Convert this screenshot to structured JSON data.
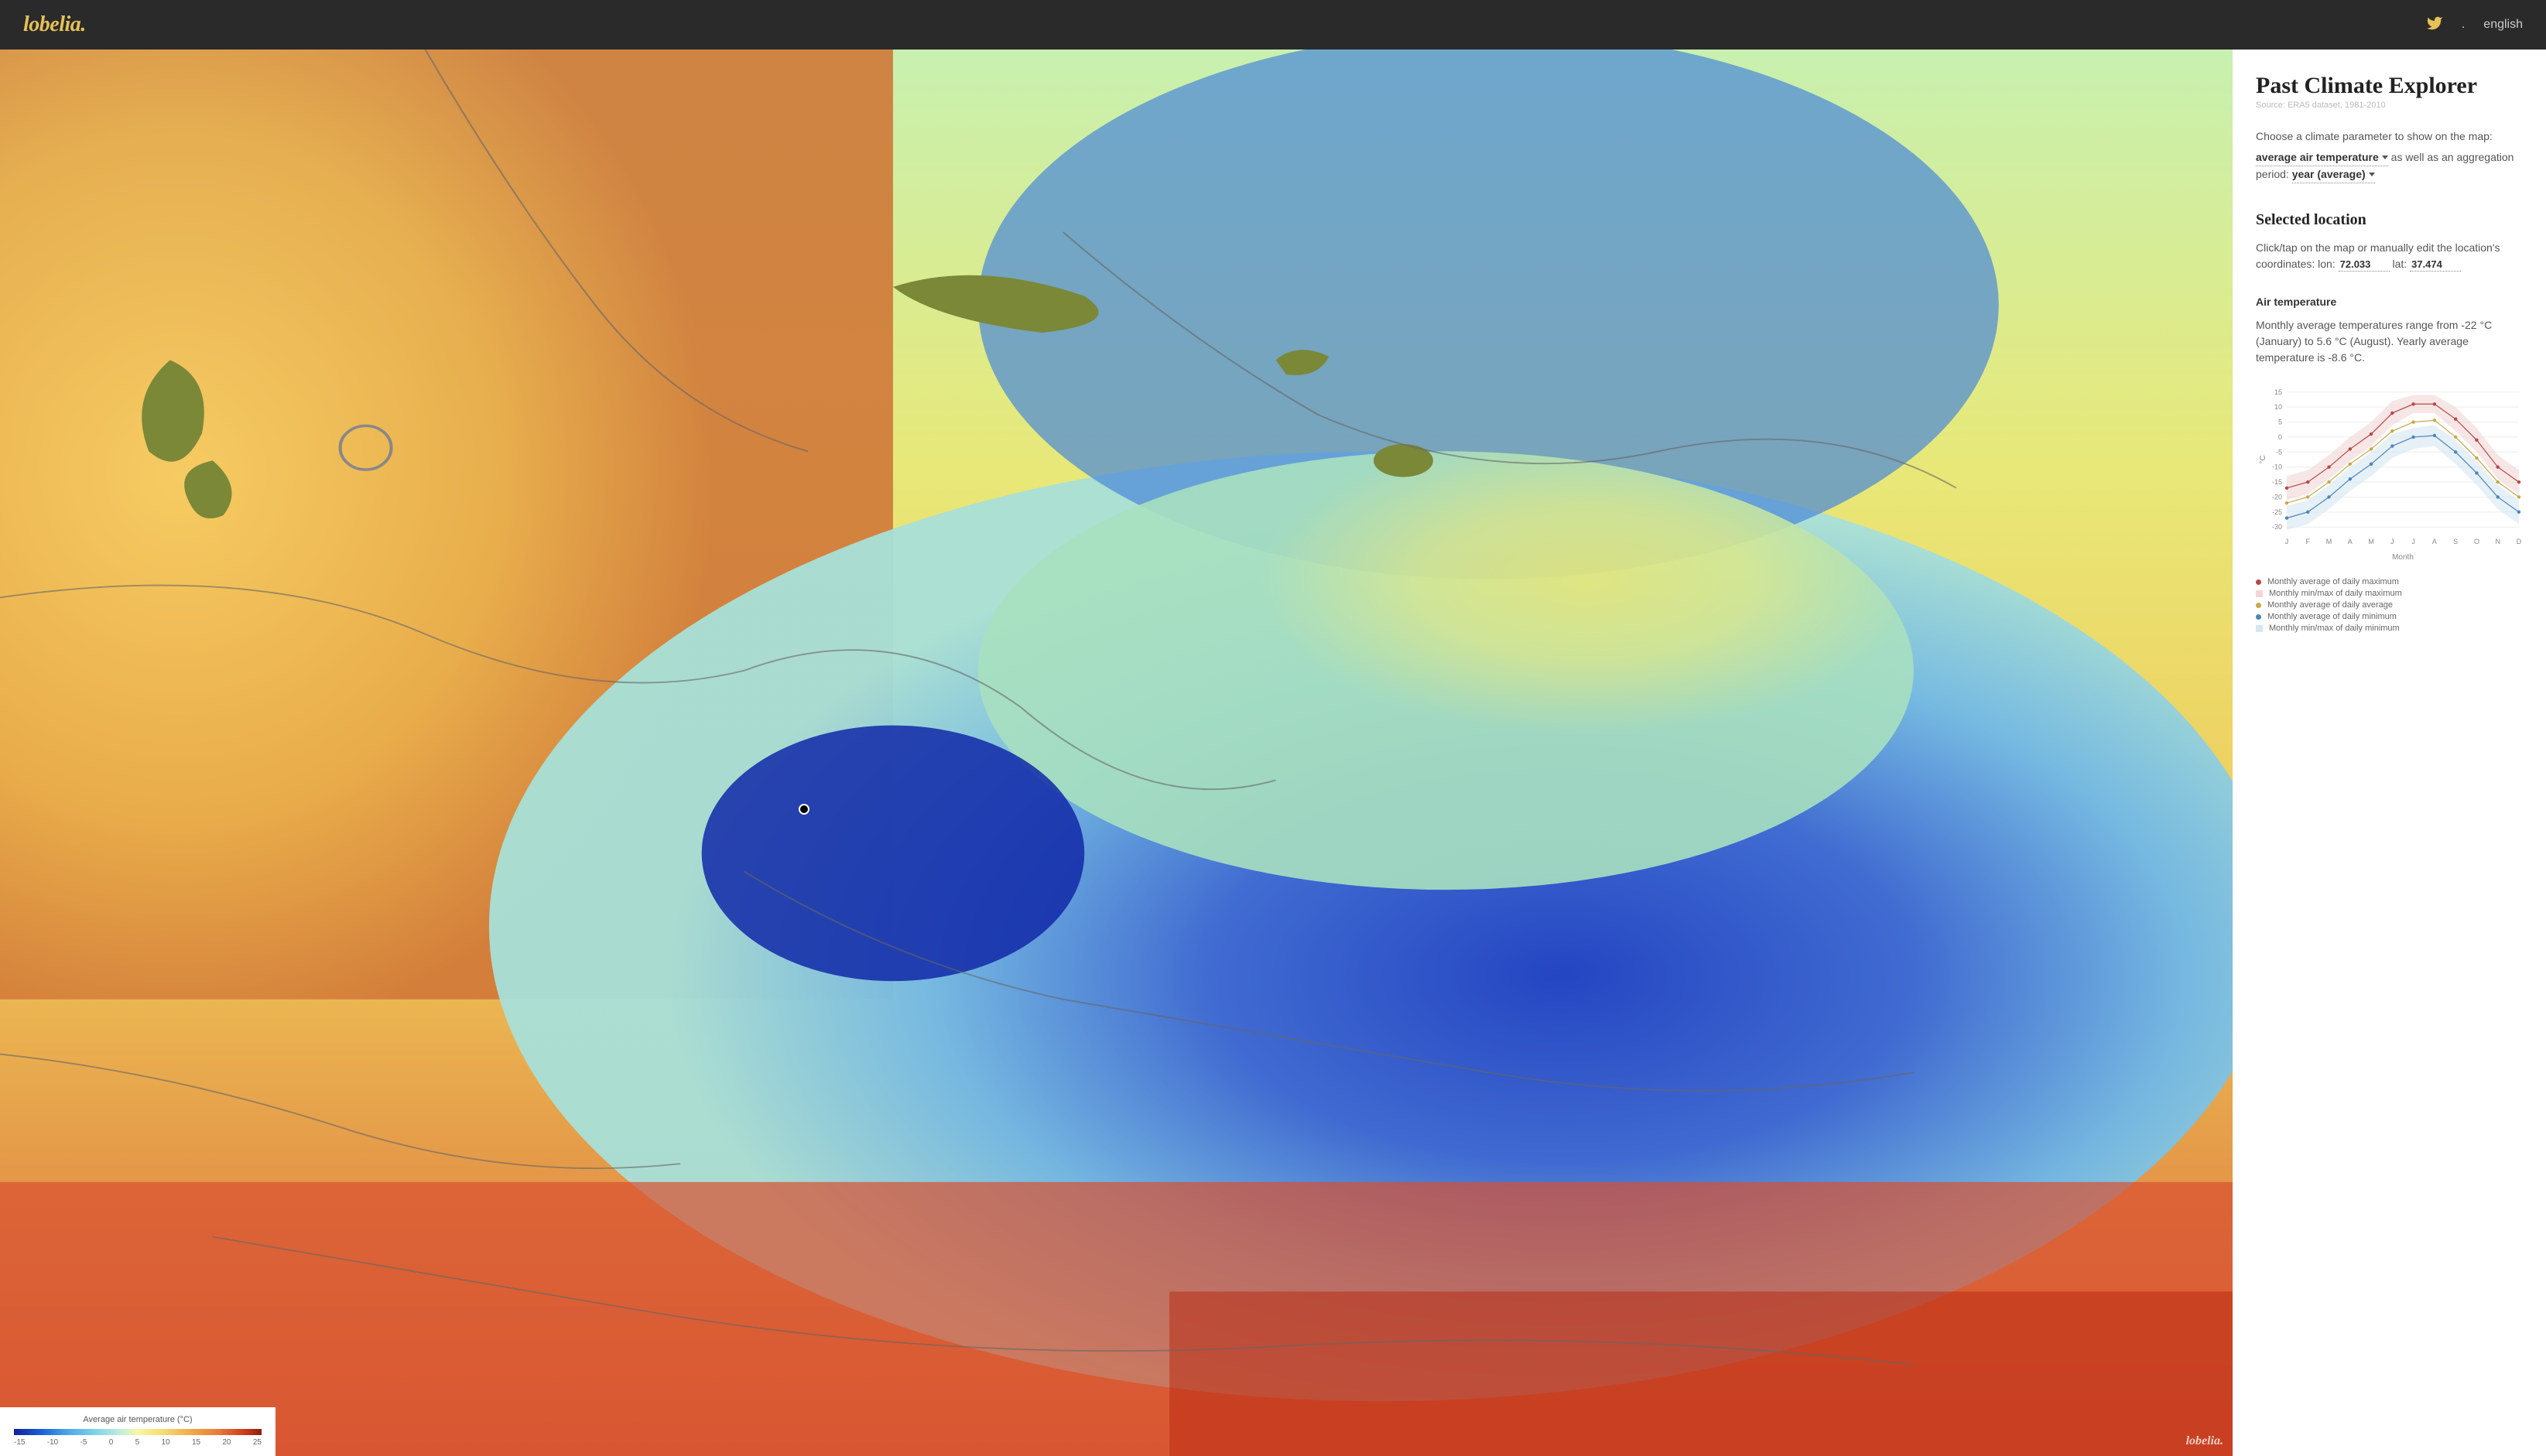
{
  "header": {
    "logo": "lobelia.",
    "dot": ".",
    "lang": "english"
  },
  "sidebar": {
    "title": "Past Climate Explorer",
    "source": "Source: ERA5 dataset, 1981-2010",
    "intro_text": "Choose a climate parameter to show on the map:",
    "parameter": "average air temperature",
    "intro_text2": " as well as an aggregation period: ",
    "period": "year (average)",
    "selected_title": "Selected location",
    "coord_text1": "Click/tap on the map or manually edit the location's coordinates: lon: ",
    "lon": "72.033",
    "coord_text2": " lat: ",
    "lat": "37.474",
    "air_temp_title": "Air temperature",
    "air_temp_body": "Monthly average temperatures range from -22 °C (January) to 5.6 °C (August). Yearly average temperature is -8.6 °C."
  },
  "map_legend": {
    "title": "Average air temperature (°C)",
    "ticks": [
      "-15",
      "-10",
      "-5",
      "0",
      "5",
      "10",
      "15",
      "20",
      "25"
    ]
  },
  "watermark": "lobelia.",
  "chart_data": {
    "type": "line",
    "title": "",
    "xlabel": "Month",
    "ylabel": "°C",
    "ylim": [
      -32,
      17
    ],
    "yticks": [
      15,
      10,
      5,
      0,
      -5,
      -10,
      -15,
      -20,
      -25,
      -30
    ],
    "categories": [
      "J",
      "F",
      "M",
      "A",
      "M",
      "J",
      "J",
      "A",
      "S",
      "O",
      "N",
      "D"
    ],
    "series": [
      {
        "name": "Monthly average of daily maximum",
        "color": "#b84848",
        "values": [
          -17,
          -15,
          -10,
          -4,
          1,
          8,
          11,
          11,
          6,
          -1,
          -10,
          -15
        ]
      },
      {
        "name": "Monthly min/max of daily maximum",
        "color": "#f2d6d6",
        "band": true,
        "low": [
          -21,
          -19,
          -14,
          -8,
          -3,
          4,
          8,
          8,
          2,
          -5,
          -14,
          -19
        ],
        "high": [
          -13,
          -11,
          -6,
          0,
          5,
          12,
          14,
          14,
          10,
          3,
          -6,
          -11
        ]
      },
      {
        "name": "Monthly average of daily average",
        "color": "#c8a848",
        "values": [
          -22,
          -20,
          -15,
          -9,
          -4,
          2,
          5,
          5.6,
          0,
          -7,
          -15,
          -20
        ]
      },
      {
        "name": "Monthly average of daily minimum",
        "color": "#4888b8",
        "values": [
          -27,
          -25,
          -20,
          -14,
          -9,
          -3,
          0,
          0.5,
          -5,
          -12,
          -20,
          -25
        ]
      },
      {
        "name": "Monthly min/max of daily minimum",
        "color": "#d6e6f2",
        "band": true,
        "low": [
          -31,
          -29,
          -24,
          -18,
          -13,
          -7,
          -4,
          -3,
          -9,
          -16,
          -24,
          -29
        ],
        "high": [
          -23,
          -21,
          -16,
          -10,
          -5,
          1,
          3,
          4,
          -1,
          -8,
          -16,
          -21
        ]
      }
    ],
    "legend": [
      {
        "label": "Monthly average of daily maximum",
        "color": "#b84848",
        "type": "dot"
      },
      {
        "label": "Monthly min/max of daily maximum",
        "color": "#f2d6d6",
        "type": "sq"
      },
      {
        "label": "Monthly average of daily average",
        "color": "#c8a848",
        "type": "dot"
      },
      {
        "label": "Monthly average of daily minimum",
        "color": "#4888b8",
        "type": "dot"
      },
      {
        "label": "Monthly min/max of daily minimum",
        "color": "#d6e6f2",
        "type": "sq"
      }
    ]
  }
}
